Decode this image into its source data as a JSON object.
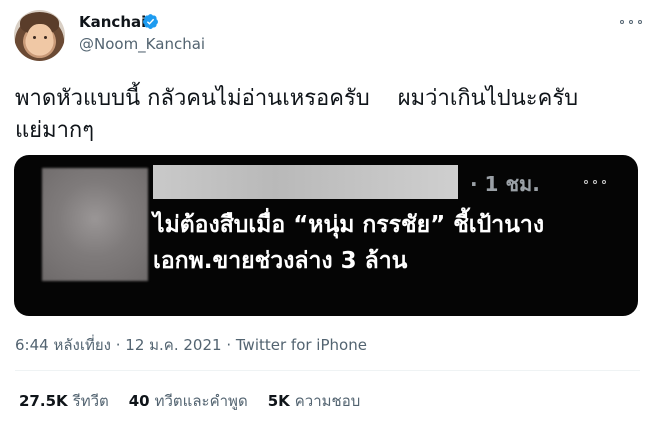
{
  "author": {
    "display_name": "Kanchai",
    "handle": "@Noom_Kanchai",
    "verified": true
  },
  "tweet": {
    "text": "พาดหัวแบบนี้ กลัวคนไม่อ่านเหรอครับ    ผมว่าเกินไปนะครับ\nแย่มากๆ",
    "timestamp": "6:44 หลังเที่ยง",
    "separator": " · ",
    "date": "12 ม.ค. 2021",
    "source": "Twitter for iPhone"
  },
  "embedded_card": {
    "time": "· 1 ชม.",
    "headline": "ไม่ต้องสืบเมื่อ “หนุ่ม กรรชัย” ชี้เป้านาง\nเอกพ.ขายช่วงล่าง 3 ล้าน",
    "background": "#050505"
  },
  "stats": [
    {
      "value": "27.5K",
      "label": "รีทวีต"
    },
    {
      "value": "40",
      "label": "ทวีตและคำพูด"
    },
    {
      "value": "5K",
      "label": "ความชอบ"
    }
  ],
  "colors": {
    "text": "#0f1419",
    "secondary": "#536471",
    "verified": "#1d9bf0"
  },
  "icons": [
    "verified-badge-icon",
    "more-options-icon"
  ]
}
